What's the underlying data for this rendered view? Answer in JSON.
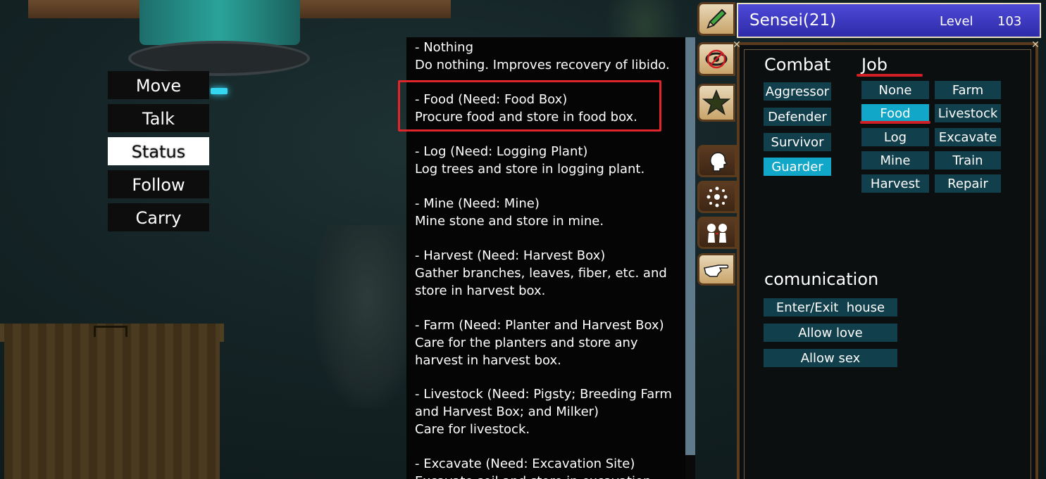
{
  "action_menu": {
    "items": [
      {
        "label": "Move"
      },
      {
        "label": "Talk"
      },
      {
        "label": "Status"
      },
      {
        "label": "Follow"
      },
      {
        "label": "Carry"
      }
    ],
    "selected": "Status"
  },
  "job_descriptions": [
    {
      "title": "- Nothing",
      "desc": "Do nothing. Improves recovery of libido."
    },
    {
      "title": "- Food (Need: Food Box)",
      "desc": "Procure food and store in food box."
    },
    {
      "title": "- Log (Need: Logging Plant)",
      "desc": "Log trees and store in logging plant."
    },
    {
      "title": "- Mine (Need: Mine)",
      "desc": "Mine stone and store in mine."
    },
    {
      "title": "- Harvest (Need: Harvest Box)",
      "desc": "Gather branches, leaves, fiber, etc. and\nstore in harvest box."
    },
    {
      "title": "- Farm (Need: Planter and Harvest Box)",
      "desc": "Care for the planters and store any\nharvest in harvest box."
    },
    {
      "title": "- Livestock (Need: Pigsty; Breeding Farm\nand Harvest Box; and Milker)",
      "desc": "Care for livestock."
    },
    {
      "title": "- Excavate (Need: Excavation Site)",
      "desc": "Excavate soil and store in excavation"
    }
  ],
  "side_tabs": [
    {
      "icon": "pencil-icon"
    },
    {
      "icon": "hidden-eye-icon"
    },
    {
      "icon": "star-icon"
    },
    {
      "icon": "head-profile-icon"
    },
    {
      "icon": "sparkle-icon"
    },
    {
      "icon": "couple-icon"
    },
    {
      "icon": "pointing-hand-icon"
    }
  ],
  "character": {
    "name": "Sensei(21)",
    "level_label": "Level",
    "level": "103"
  },
  "combat": {
    "title": "Combat",
    "options": [
      "Aggressor",
      "Defender",
      "Survivor",
      "Guarder"
    ],
    "selected": "Guarder"
  },
  "job": {
    "title": "Job",
    "options": [
      "None",
      "Farm",
      "Food",
      "Livestock",
      "Log",
      "Excavate",
      "Mine",
      "Train",
      "Harvest",
      "Repair"
    ],
    "selected": "Food"
  },
  "communication": {
    "title": "comunication",
    "options": [
      "Enter/Exit  house",
      "Allow love",
      "Allow sex"
    ]
  },
  "colors": {
    "active_button": "#11a7c8",
    "button": "#123f4c",
    "annotation_red": "#e0262a",
    "name_bar": "#3a36c4"
  }
}
